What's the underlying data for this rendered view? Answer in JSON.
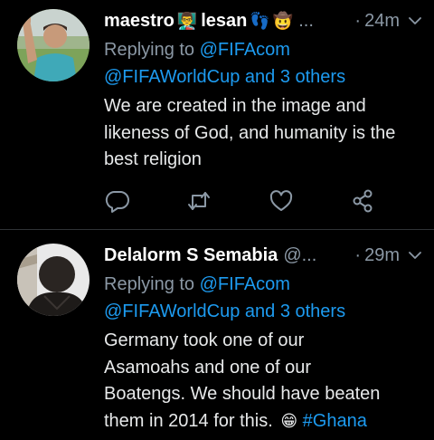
{
  "colors": {
    "background": "#000000",
    "text": "#e7e9ea",
    "muted": "#8b98a5",
    "link": "#1d9bf0",
    "divider": "#2f3336"
  },
  "tweets": [
    {
      "display_name": "maestro",
      "emoji1": "👨‍🏫",
      "name_part2": "lesan",
      "emoji2": "👣",
      "emoji3": "🤠",
      "ellipsis": "...",
      "time": "24m",
      "replying_prefix": "Replying to ",
      "mention1": "@FIFAcom",
      "mention2_line": "@FIFAWorldCup and 3 others",
      "body_lines": [
        "We are created in the image and",
        "likeness of God, and humanity is the",
        "best religion"
      ],
      "avatar_icon": "referee-avatar",
      "action_icons": [
        "reply-icon",
        "retweet-icon",
        "like-icon",
        "share-icon"
      ]
    },
    {
      "display_name": "Delalorm S Semabia",
      "handle": "@...",
      "time": "29m",
      "replying_prefix": "Replying to ",
      "mention1": "@FIFAcom",
      "mention2_line": "@FIFAWorldCup and 3 others",
      "body_lines": [
        "Germany took one of our",
        "Asamoahs and one of our",
        "Boatengs. We should have beaten",
        "them in 2014 for this."
      ],
      "emoji_end": "😁",
      "hashtag": "#Ghana",
      "avatar_icon": "person-avatar"
    }
  ]
}
